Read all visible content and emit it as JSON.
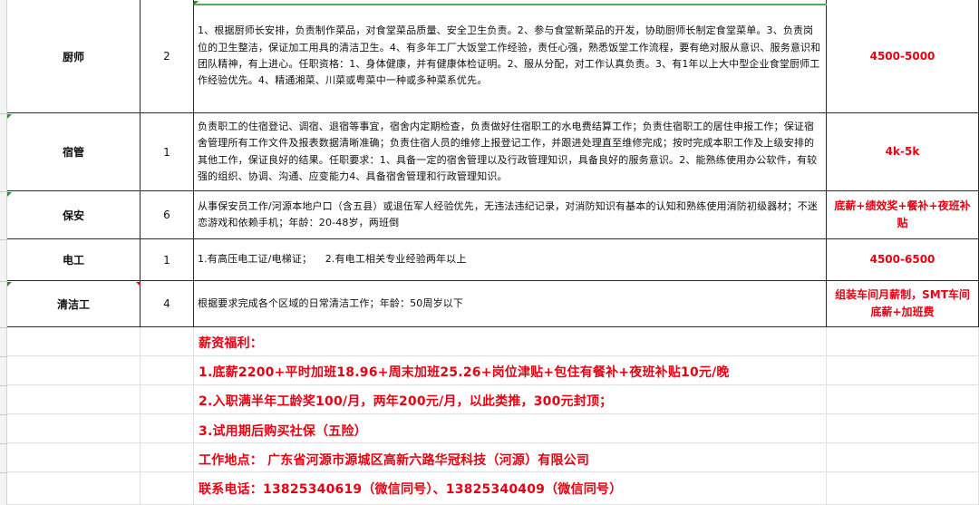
{
  "jobs": [
    {
      "position": "厨师",
      "count": "2",
      "description": "1、根据厨师长安排，负责制作菜品，对食堂菜品质量、安全卫生负责。2、参与食堂新菜品的开发，协助厨师长制定食堂菜单。3、负责岗位的卫生整洁，保证加工用具的清洁卫生。4、有多年工厂大饭堂工作经验，责任心强，熟悉饭堂工作流程，要有绝对服从意识、服务意识和团队精神，有上进心。任职资格：1、身体健康，并有健康体检证明。2、服从分配，对工作认真负责。3、有1年以上大中型企业食堂厨师工作经验优先。4、精通湘菜、川菜或粤菜中一种或多种菜系优先。",
      "salary": "4500-5000"
    },
    {
      "position": "宿管",
      "count": "1",
      "description": "负责职工的住宿登记、调宿、退宿等事宜，宿舍内定期检查，负责做好住宿职工的水电费结算工作；负责住宿职工的居住申报工作；保证宿舍管理所有工作文件及报表数据清晰准确；负责住宿人员的维修上报登记工作，并跟进处理直至维修完成；按时完成本职工作及上级安排的其他工作，保证良好的结果。任职要求：1、具备一定的宿舍管理以及行政管理知识，具备良好的服务意识。2、能熟练使用办公软件，有较强的组织、协调、沟通、应变能力4、具备宿舍管理和行政管理知识。",
      "salary": "4k-5k"
    },
    {
      "position": "保安",
      "count": "6",
      "description": "从事保安员工作/河源本地户口（含五县）或退伍军人经验优先，无违法违纪记录，对消防知识有基本的认知和熟练使用消防初级器材；不迷恋游戏和依赖手机；年龄：20-48岁，两班倒",
      "salary": "底薪+绩效奖+餐补+夜班补贴"
    },
    {
      "position": "电工",
      "count": "1",
      "description": "1.有高压电工证/电梯证；    2.有电工相关专业经验两年以上",
      "salary": "4500-6500"
    },
    {
      "position": "清洁工",
      "count": "4",
      "description": "根据要求完成各个区域的日常清洁工作；年龄：50周岁以下",
      "salary": "组装车间月薪制，SMT车间底薪+加班费"
    }
  ],
  "benefits": {
    "heading": "薪资福利：",
    "item1": "1.底薪2200+平时加班18.96+周末加班25.26+岗位津贴+包住有餐补+夜班补贴10元/晚",
    "item2": "2.入职满半年工龄奖100/月，两年200元/月，以此类推，300元封顶；",
    "item3": "3.试用期后购买社保（五险）",
    "address": "工作地点： 广东省河源市源城区高新六路华冠科技（河源）有限公司",
    "phone": "联系电话：13825340619（微信同号）、13825340409（微信同号）"
  },
  "colors": {
    "accent_red": "#e60012",
    "marker_green": "#2e8b2e"
  }
}
